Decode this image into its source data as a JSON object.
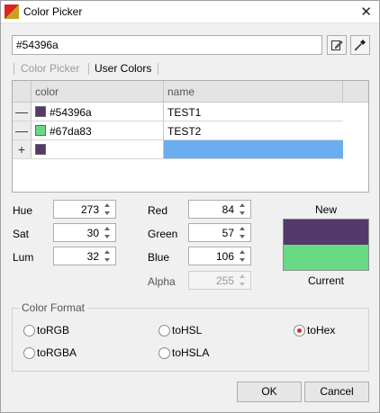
{
  "window": {
    "title": "Color Picker"
  },
  "hex_value": "#54396a",
  "tabs": [
    {
      "label": "Color Picker",
      "active": false
    },
    {
      "label": "User Colors",
      "active": true
    }
  ],
  "table": {
    "columns": [
      "color",
      "name"
    ],
    "rows": [
      {
        "marker": "—",
        "color": "#54396a",
        "swatch": "#54396a",
        "name": "TEST1"
      },
      {
        "marker": "—",
        "color": "#67da83",
        "swatch": "#67da83",
        "name": "TEST2"
      },
      {
        "marker": "+",
        "color": "",
        "swatch": "#54396a",
        "name": ""
      }
    ]
  },
  "hsl": {
    "hue_label": "Hue",
    "hue": "273",
    "sat_label": "Sat",
    "sat": "30",
    "lum_label": "Lum",
    "lum": "32"
  },
  "rgb": {
    "red_label": "Red",
    "red": "84",
    "green_label": "Green",
    "green": "57",
    "blue_label": "Blue",
    "blue": "106",
    "alpha_label": "Alpha",
    "alpha": "255"
  },
  "preview": {
    "new_label": "New",
    "new_color": "#54396a",
    "current_label": "Current",
    "current_color": "#67da83"
  },
  "color_format": {
    "title": "Color Format",
    "options": [
      "toRGB",
      "toHSL",
      "toHex",
      "toRGBA",
      "toHSLA"
    ],
    "selected": "toHex"
  },
  "buttons": {
    "ok": "OK",
    "cancel": "Cancel"
  }
}
